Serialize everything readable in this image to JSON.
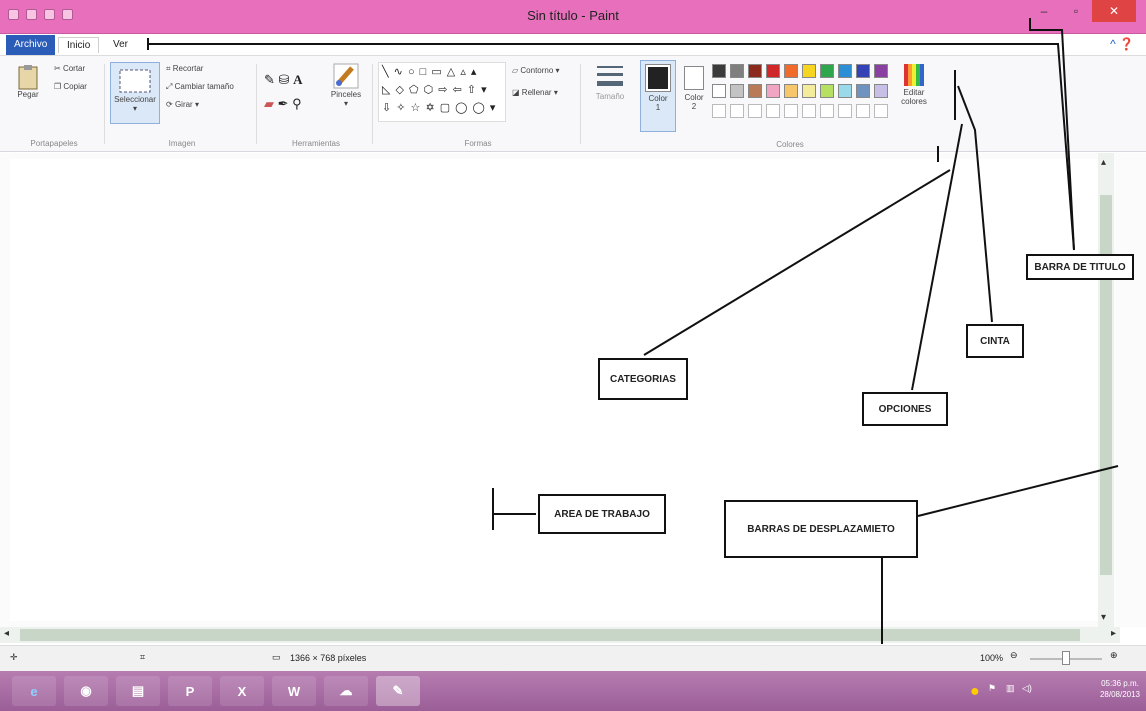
{
  "window": {
    "title": "Sin título - Paint",
    "controls": {
      "minimize": "–",
      "maximize": "▫",
      "close": "✕"
    }
  },
  "menu": {
    "file": "Archivo",
    "home": "Inicio",
    "view": "Ver",
    "help_icons": "^ ❓"
  },
  "ribbon": {
    "portapapeles": {
      "name": "Portapapeles",
      "paste": "Pegar",
      "cut": "Cortar",
      "copy": "Copiar"
    },
    "imagen": {
      "name": "Imagen",
      "select": "Seleccionar",
      "crop": "Recortar",
      "resize": "Cambiar tamaño",
      "rotate": "Girar ▾"
    },
    "herramientas": {
      "name": "Herramientas",
      "brushes": "Pinceles",
      "text_tool": "A"
    },
    "formas": {
      "name": "Formas",
      "outline": "Contorno ▾",
      "fill": "Rellenar ▾",
      "shapes_row1": "╲ ∿ ○ □ ▭ △ ▵ ▴",
      "shapes_row2": "◺ ◇ ⬠ ⬡ ⇨ ⇦ ⇧ ▾",
      "shapes_row3": "⇩ ✧ ☆ ✡ ▢ ◯ ◯ ▾"
    },
    "size": "Tamaño",
    "color1": {
      "label": "Color",
      "num": "1"
    },
    "color2": {
      "label": "Color",
      "num": "2"
    },
    "colores": {
      "name": "Colores",
      "edit_top": "Editar",
      "edit_bottom": "colores"
    },
    "palette_row1": [
      "#3a3a3a",
      "#7f7f7f",
      "#8b2b1e",
      "#d0282a",
      "#f06b2b",
      "#f5d522",
      "#2ea64c",
      "#2c8fd6",
      "#3342b4",
      "#8940a1"
    ],
    "palette_row2": [
      "#ffffff",
      "#c3c3c3",
      "#b97a57",
      "#f2a5c2",
      "#f7c56a",
      "#f2ec9c",
      "#b5e061",
      "#99d9ea",
      "#7092be",
      "#c8bfe7"
    ]
  },
  "status": {
    "dimensions": "1366 × 768 píxeles",
    "zoom": "100%"
  },
  "taskbar": {
    "time": "05:36 p.m.",
    "date": "28/08/2013",
    "apps": [
      "e",
      "◉",
      "▤",
      "P",
      "X",
      "W",
      "☁",
      "✎"
    ]
  },
  "annotations": {
    "titlebar": "BARRA DE TITULO",
    "ribbon": "CINTA",
    "categories": "CATEGORIAS",
    "options": "OPCIONES",
    "workspace": "AREA DE TRABAJO",
    "scrollbars": "BARRAS DE DESPLAZAMIETO"
  }
}
